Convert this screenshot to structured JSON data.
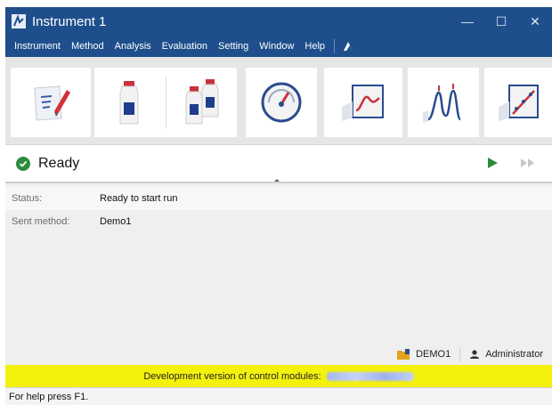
{
  "window": {
    "title": "Instrument 1"
  },
  "menu": [
    "Instrument",
    "Method",
    "Analysis",
    "Evaluation",
    "Setting",
    "Window",
    "Help"
  ],
  "toolbar": {
    "tools": [
      {
        "name": "edit-method-icon"
      },
      {
        "name": "single-sample-icon"
      },
      {
        "name": "sample-series-icon"
      },
      {
        "name": "gauge-icon"
      },
      {
        "name": "chromatogram-monitor-icon"
      },
      {
        "name": "peaks-analysis-icon"
      },
      {
        "name": "calibration-icon"
      }
    ]
  },
  "status": {
    "text": "Ready",
    "color": "#2e8b3e"
  },
  "details": [
    {
      "label": "Status:",
      "value": "Ready to start run"
    },
    {
      "label": "Sent method:",
      "value": "Demo1"
    }
  ],
  "footer": {
    "project": "DEMO1",
    "user": "Administrator"
  },
  "dev_notice": "Development version of control modules:",
  "help": "For help press F1.",
  "colors": {
    "title_bg": "#1e4f8c",
    "dev_bar": "#f3f10d",
    "play": "#2e8b3e"
  }
}
